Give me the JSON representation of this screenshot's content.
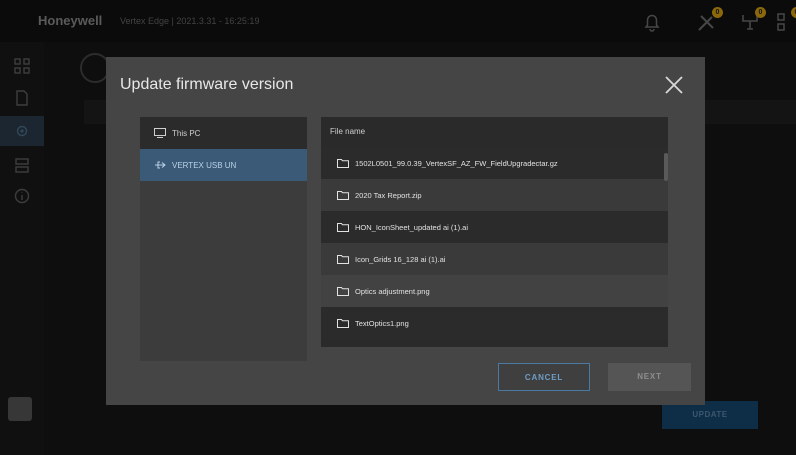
{
  "app": {
    "brand": "Honeywell",
    "subtitle": "Vertex Edge | 2021.3.31 - 16:25:19",
    "update_label": "UPDATE",
    "badges": {
      "tools": "0",
      "network": "0",
      "device": "0"
    }
  },
  "icons": {
    "topbar": [
      "bell-icon",
      "tools-icon",
      "network-icon",
      "device-icon"
    ],
    "sidebar": [
      "grid-icon",
      "document-icon",
      "settings-icon",
      "database-icon",
      "info-icon"
    ]
  },
  "dialog": {
    "title": "Update firmware version",
    "sources": [
      {
        "label": "This PC",
        "icon": "computer-icon",
        "selected": false
      },
      {
        "label": "VERTEX USB UN",
        "icon": "usb-icon",
        "selected": true
      }
    ],
    "files_header": "File name",
    "files": [
      "1502L0501_99.0.39_VertexSF_AZ_FW_FieldUpgradectar.gz",
      "2020 Tax Report.zip",
      "HON_IconSheet_updated ai (1).ai",
      "Icon_Grids 16_128 ai (1).ai",
      "Optics adjustment.png",
      "TextOptics1.png"
    ],
    "cancel_label": "CANCEL",
    "next_label": "NEXT"
  },
  "colors": {
    "accent": "#3a5a78",
    "cancel_border": "#4a7aa4",
    "badge": "#d6a00f"
  }
}
